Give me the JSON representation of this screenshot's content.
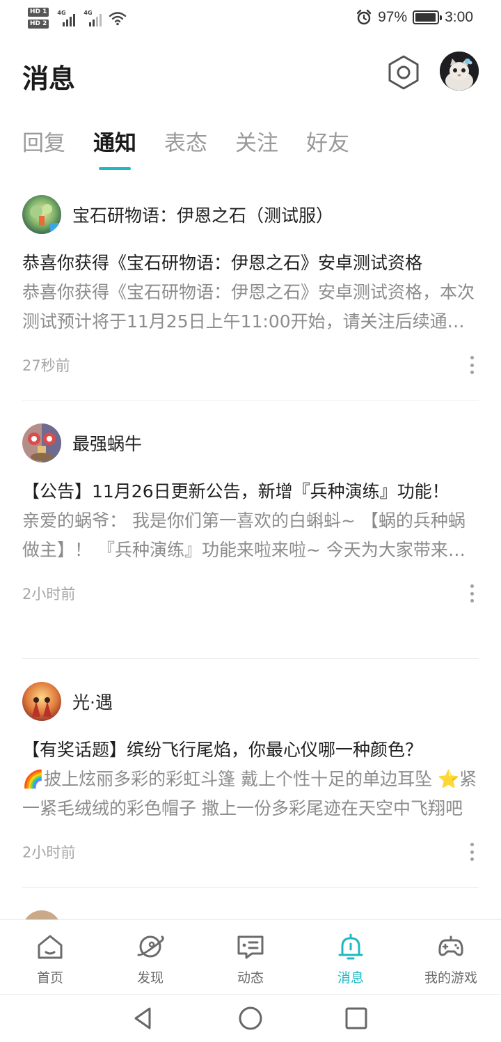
{
  "status_bar": {
    "hd1": "HD 1",
    "hd2": "HD 2",
    "sim1_tag": "4G",
    "sim2_tag": "4G",
    "battery_percent": "97%",
    "battery_level": 0.97,
    "time": "3:00"
  },
  "header": {
    "title": "消息",
    "settings_icon": "hexagon-settings-icon",
    "avatar_icon": "user-avatar"
  },
  "tabs": [
    {
      "label": "回复",
      "active": false
    },
    {
      "label": "通知",
      "active": true
    },
    {
      "label": "表态",
      "active": false
    },
    {
      "label": "关注",
      "active": false
    },
    {
      "label": "好友",
      "active": false
    }
  ],
  "notifications": [
    {
      "source": "宝石研物语：伊恩之石（测试服）",
      "headline": "恭喜你获得《宝石研物语：伊恩之石》安卓测试资格",
      "summary": "恭喜你获得《宝石研物语：伊恩之石》安卓测试资格，本次测试预计将于11月25日上午11:00开始，请关注后续通知。",
      "time": "27秒前"
    },
    {
      "source": "最强蜗牛",
      "headline": "【公告】11月26日更新公告，新增『兵种演练』功能！",
      "summary": "亲爱的蜗爷： 我是你们第一喜欢的白蝌蚪~ 【蜗的兵种蜗做主】！ 『兵种演练』功能来啦来啦~ 今天为大家带来全新玩法。",
      "time": "2小时前"
    },
    {
      "source": "光·遇",
      "headline": "【有奖话题】缤纷飞行尾焰，你最心仪哪一种颜色？",
      "summary": "🌈披上炫丽多彩的彩虹斗篷 戴上个性十足的单边耳坠 ⭐紧一紧毛绒绒的彩色帽子 撒上一份多彩尾迹在天空中飞翔吧",
      "time": "2小时前"
    }
  ],
  "bottom_nav": [
    {
      "label": "首页",
      "icon": "home-icon",
      "active": false
    },
    {
      "label": "发现",
      "icon": "planet-icon",
      "active": false
    },
    {
      "label": "动态",
      "icon": "chat-bubble-icon",
      "active": false
    },
    {
      "label": "消息",
      "icon": "bell-icon",
      "active": true
    },
    {
      "label": "我的游戏",
      "icon": "gamepad-icon",
      "active": false
    }
  ],
  "colors": {
    "accent": "#1fb8c3",
    "text_primary": "#1f1f1f",
    "text_secondary": "#8c8c8c",
    "text_muted": "#a6a6a6"
  }
}
